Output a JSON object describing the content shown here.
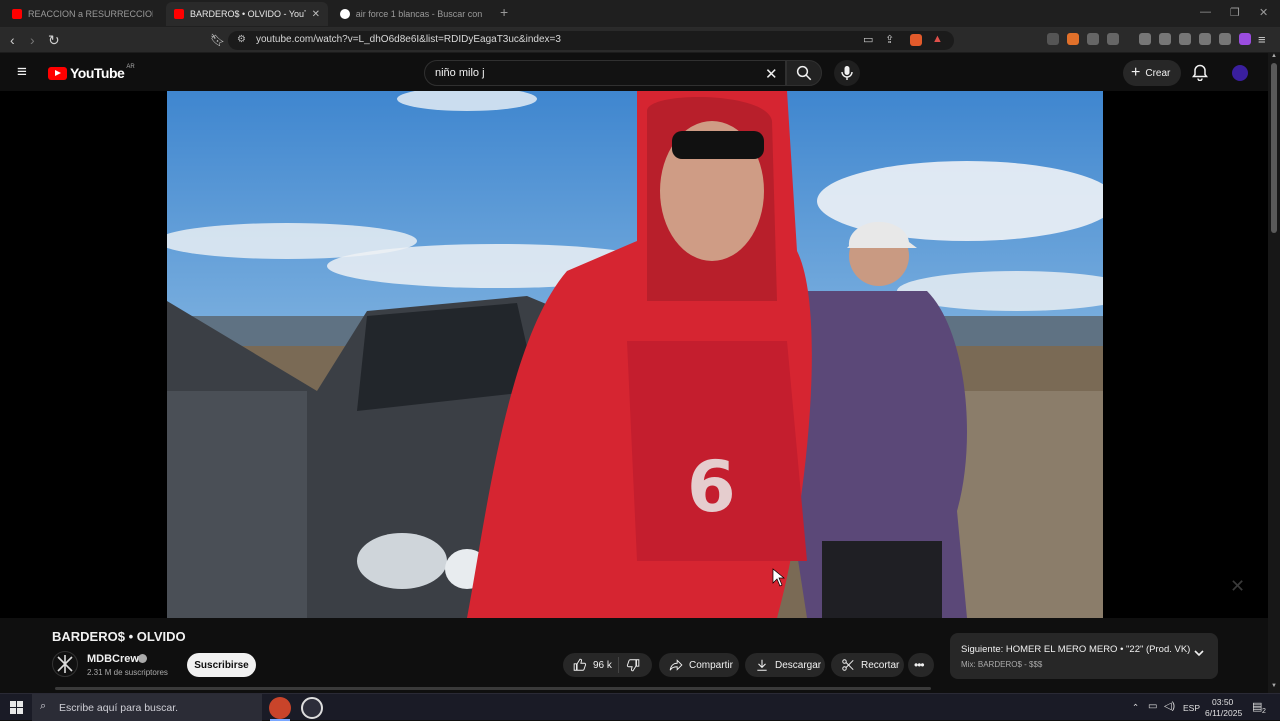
{
  "browser": {
    "tabs": [
      {
        "label": "REACCION a RESURRECCION - Hom",
        "active": false
      },
      {
        "label": "BARDERO$ • OLVIDO - YouTu",
        "active": true
      },
      {
        "label": "air force 1 blancas - Buscar con Goog",
        "active": false
      }
    ],
    "url": "youtube.com/watch?v=L_dhO6d8e6I&list=RDIDyEagaT3uc&index=3",
    "new_tab": "+"
  },
  "youtube": {
    "logo_text": "YouTube",
    "country_code": "AR",
    "search_value": "niño milo j",
    "create_label": "Crear"
  },
  "video": {
    "title": "BARDERO$ • OLVIDO",
    "channel_name": "MDBCrew",
    "subscribers": "2.31 M de suscriptores",
    "subscribe_label": "Suscribirse",
    "likes": "96 k",
    "share_label": "Compartir",
    "download_label": "Descargar",
    "clip_label": "Recortar"
  },
  "next_up": {
    "title": "Siguiente: HOMER EL MERO MERO • \"22\" (Prod. VK)",
    "subtitle": "Mix: BARDERO$ - $$$"
  },
  "taskbar": {
    "search_placeholder": "Escribe aquí para buscar.",
    "language": "ESP",
    "time": "03:50",
    "date": "6/11/2025",
    "notification_count": "2"
  },
  "colors": {
    "youtube_red": "#ff0000",
    "background": "#0f0f0f",
    "pill": "#272727"
  }
}
